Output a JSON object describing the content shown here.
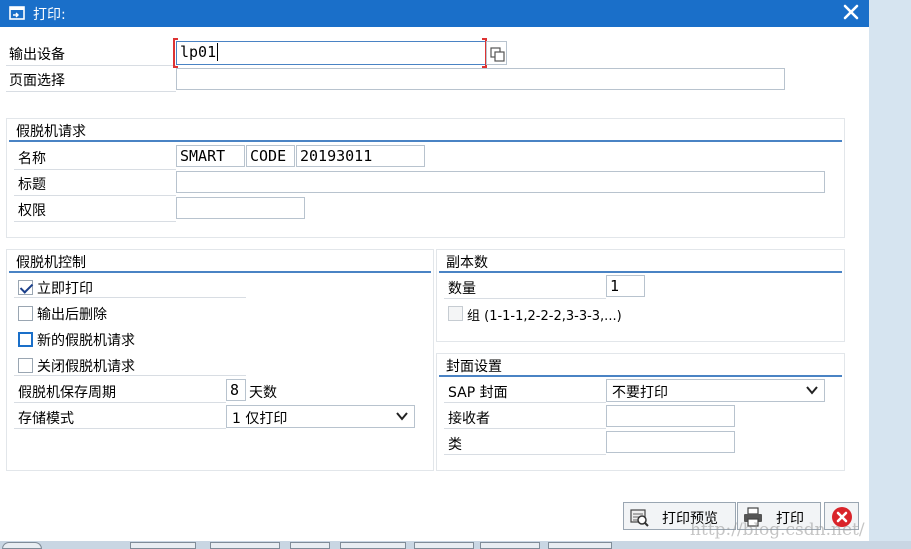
{
  "window": {
    "title": "打印:",
    "close_icon": "close-icon",
    "title_icon": "print-dialog-icon"
  },
  "device": {
    "label": "输出设备",
    "value": "lp01"
  },
  "page_select": {
    "label": "页面选择",
    "value": ""
  },
  "spool_request": {
    "title": "假脱机请求",
    "name_label": "名称",
    "name_parts": [
      "SMART",
      "CODE",
      "20193011"
    ],
    "title_label": "标题",
    "title_value": "",
    "auth_label": "权限",
    "auth_value": ""
  },
  "spool_control": {
    "title": "假脱机控制",
    "print_now": {
      "label": "立即打印",
      "checked": true
    },
    "delete_after": {
      "label": "输出后删除",
      "checked": false
    },
    "new_request": {
      "label": "新的假脱机请求",
      "checked": false
    },
    "close_request": {
      "label": "关闭假脱机请求",
      "checked": false
    },
    "retention_label": "假脱机保存周期",
    "retention_value": "8",
    "retention_unit": "天数",
    "storage_label": "存储模式",
    "storage_value": "1 仅打印"
  },
  "copies": {
    "title": "副本数",
    "qty_label": "数量",
    "qty_value": "1",
    "group_label": "组 (1-1-1,2-2-2,3-3-3,...)"
  },
  "cover": {
    "title": "封面设置",
    "sap_cover_label": "SAP 封面",
    "sap_cover_value": "不要打印",
    "recipient_label": "接收者",
    "recipient_value": "",
    "dept_label": "类",
    "dept_value": ""
  },
  "buttons": {
    "preview": "打印预览",
    "print": "打印"
  },
  "watermark": "http://blog.csdn.net/",
  "colors": {
    "title_bar": "#1a6fc9",
    "group_accent": "#4a83c4",
    "cancel": "#d9242a"
  }
}
